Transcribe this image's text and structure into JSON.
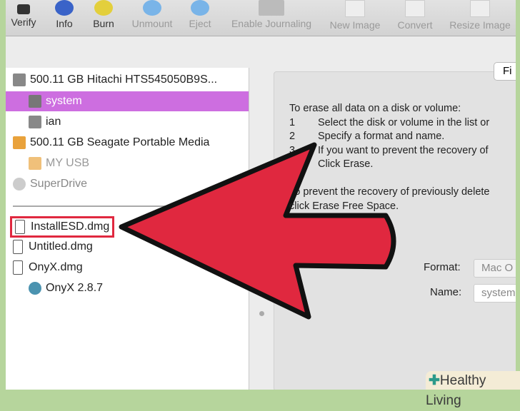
{
  "toolbar": {
    "items": [
      {
        "label": "Verify",
        "icon": "microscope-icon",
        "enabled": true
      },
      {
        "label": "Info",
        "icon": "info-icon",
        "enabled": true
      },
      {
        "label": "Burn",
        "icon": "radiation-icon",
        "enabled": true
      },
      {
        "label": "Unmount",
        "icon": "unmount-icon",
        "enabled": false
      },
      {
        "label": "Eject",
        "icon": "eject-icon",
        "enabled": false
      },
      {
        "label": "Enable Journaling",
        "icon": "journaling-icon",
        "enabled": false
      },
      {
        "label": "New Image",
        "icon": "new-image-icon",
        "enabled": false
      },
      {
        "label": "Convert",
        "icon": "convert-icon",
        "enabled": false
      },
      {
        "label": "Resize Image",
        "icon": "resize-image-icon",
        "enabled": false
      }
    ]
  },
  "sidebar": {
    "items": [
      {
        "label": "500.11 GB Hitachi HTS545050B9S...",
        "icon": "hard-drive-icon"
      },
      {
        "label": "system",
        "icon": "volume-icon",
        "selected": true
      },
      {
        "label": "ian",
        "icon": "volume-icon"
      },
      {
        "label": "500.11 GB Seagate Portable Media",
        "icon": "external-drive-icon"
      },
      {
        "label": "MY USB",
        "icon": "external-volume-icon"
      },
      {
        "label": "SuperDrive",
        "icon": "optical-drive-icon"
      },
      {
        "label": "InstallESD.dmg",
        "icon": "disk-image-icon",
        "highlighted": true
      },
      {
        "label": "Untitled.dmg",
        "icon": "disk-image-icon"
      },
      {
        "label": "OnyX.dmg",
        "icon": "disk-image-icon"
      },
      {
        "label": "OnyX 2.8.7",
        "icon": "mounted-volume-icon"
      }
    ]
  },
  "panel": {
    "tab_label": "Fi",
    "intro": "To erase all data on a disk or volume:",
    "steps": [
      {
        "n": "1",
        "text": "Select the disk or volume in the list or"
      },
      {
        "n": "2",
        "text": "Specify a format and name."
      },
      {
        "n": "3",
        "text": "If you want to prevent the recovery of"
      },
      {
        "n": "",
        "text": "Click Erase."
      }
    ],
    "free_space_1": "To prevent the recovery of previously delete",
    "free_space_2": "click Erase Free Space.",
    "format_label": "Format:",
    "format_value": "Mac O",
    "name_label": "Name:",
    "name_value": "system"
  },
  "watermark": "Healthy Living",
  "colors": {
    "selection": "#cd6ee0",
    "arrow": "#e0283f",
    "highlight_box": "#e0283f",
    "border": "#b6d59c"
  }
}
